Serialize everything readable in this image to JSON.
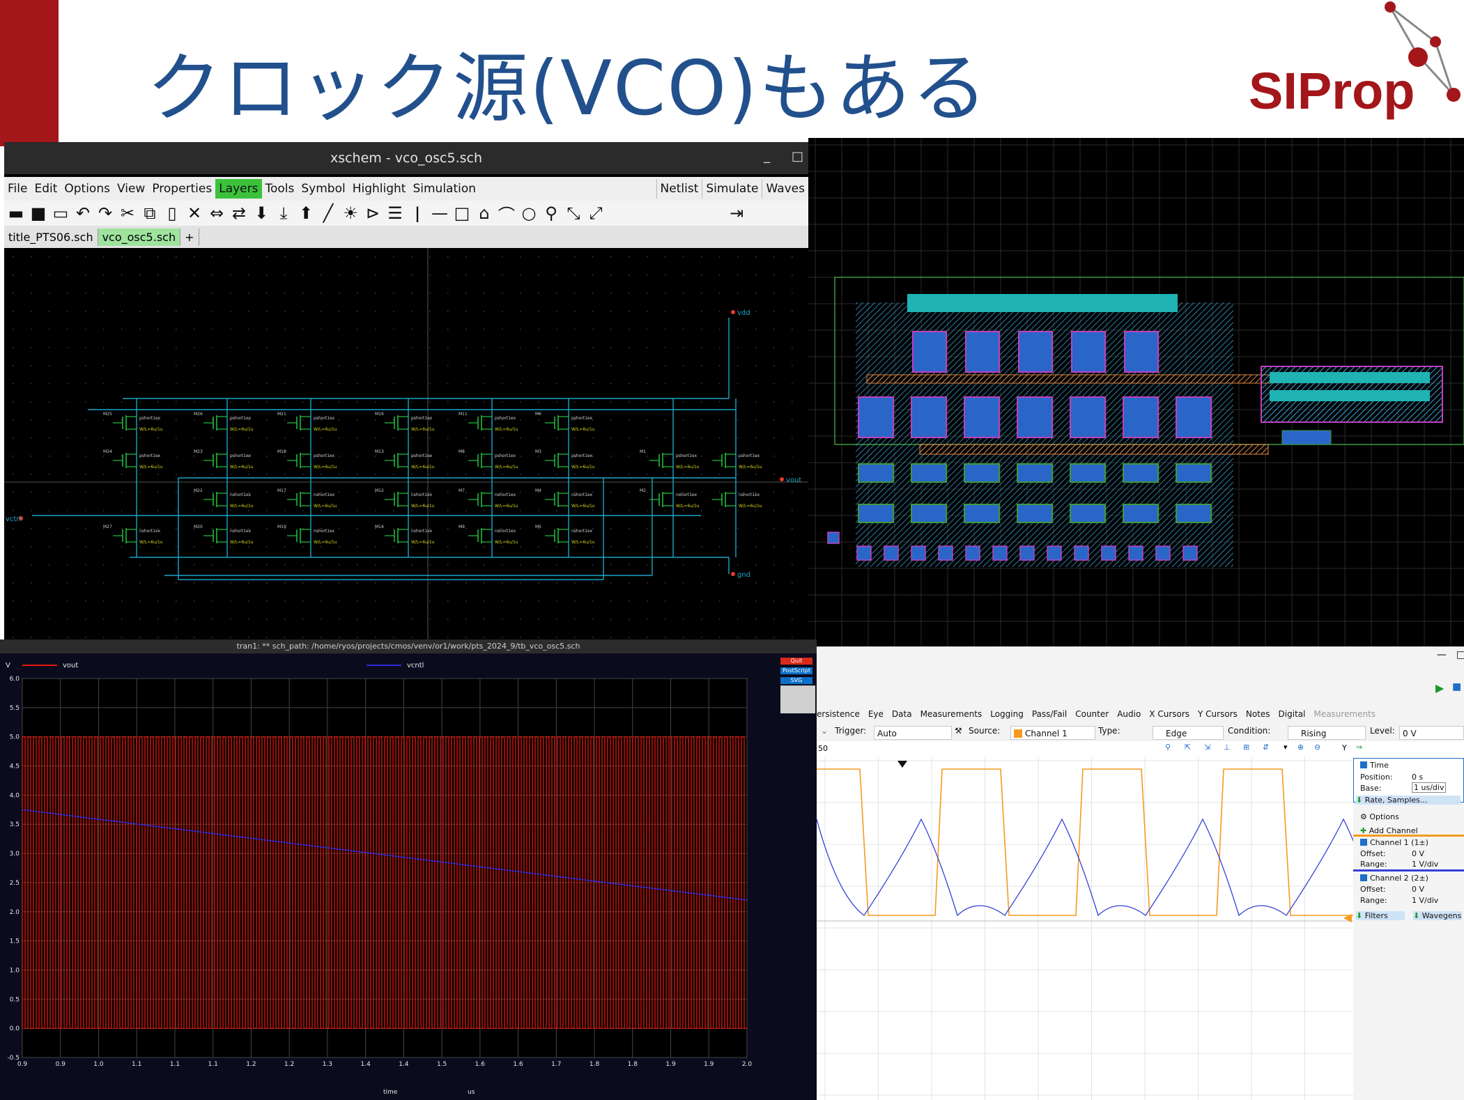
{
  "slide": {
    "title": "クロック源(VCO)もある",
    "logo_text": "SIProp",
    "colors": {
      "accent_red": "#a3161a",
      "title_blue": "#22508d"
    }
  },
  "xschem": {
    "window_title": "xschem - vco_osc5.sch",
    "menu": [
      "File",
      "Edit",
      "Options",
      "View",
      "Properties",
      "Layers",
      "Tools",
      "Symbol",
      "Highlight",
      "Simulation"
    ],
    "menu_right": [
      "Netlist",
      "Simulate",
      "Waves"
    ],
    "tabs": [
      "title_PTS06.sch",
      "vco_osc5.sch",
      "+"
    ],
    "net_labels": {
      "vdd": "vdd",
      "vout": "vout",
      "vctrl": "vctrl",
      "gnd": "gnd"
    },
    "pmos_top": [
      "M25",
      "M26",
      "M21",
      "M16",
      "M11",
      "M6"
    ],
    "pmos_mid": [
      "M24",
      "M23",
      "M18",
      "M13",
      "M8",
      "M3",
      "M1"
    ],
    "nmos_mid": [
      "M22",
      "M17",
      "M12",
      "M7",
      "M4",
      "M2"
    ],
    "nmos_bot": [
      "M27",
      "M20",
      "M19",
      "M14",
      "M9",
      "M5"
    ],
    "dev_text": {
      "pmos": "pshort1ex",
      "nmos": "nshort1ex",
      "wl": "W/L=6u/1u"
    }
  },
  "waveform": {
    "title": "tran1: ** sch_path: /home/ryos/projects/cmos/venv/or1/work/pts_2024_9/tb_vco_osc5.sch",
    "ylabel": "V",
    "xlabel": "time",
    "xunit": "us",
    "buttons": [
      "Quit",
      "PostScript",
      "SVG"
    ]
  },
  "chart_data": {
    "type": "line",
    "title": "",
    "xlabel": "time",
    "ylabel": "V",
    "xlim": [
      0.9,
      2.0
    ],
    "ylim": [
      -0.5,
      6.0
    ],
    "x_ticks": [
      "0.9",
      "0.9",
      "1.0",
      "1.1",
      "1.1",
      "1.1",
      "1.2",
      "1.2",
      "1.3",
      "1.4",
      "1.4",
      "1.5",
      "1.6",
      "1.6",
      "1.7",
      "1.8",
      "1.8",
      "1.9",
      "1.9",
      "2.0"
    ],
    "y_ticks": [
      "-0.5",
      "0.0",
      "0.5",
      "1.0",
      "1.5",
      "2.0",
      "2.5",
      "3.0",
      "3.5",
      "4.0",
      "4.5",
      "5.0",
      "5.5",
      "6.0"
    ],
    "series": [
      {
        "name": "vout",
        "color": "#e8160c",
        "style": "square oscillation between 0.0 V and 5.0 V",
        "x": [
          0.9,
          2.0
        ],
        "low": 0.0,
        "high": 5.0,
        "cycles": 130
      },
      {
        "name": "vcntl",
        "color": "#2b2bd6",
        "x": [
          0.9,
          2.0
        ],
        "values": [
          3.75,
          2.2
        ]
      }
    ]
  },
  "scope": {
    "menu": [
      "ersistence",
      "Eye",
      "Data",
      "Measurements",
      "Logging",
      "Pass/Fail",
      "Counter",
      "Audio",
      "X Cursors",
      "Y Cursors",
      "Notes",
      "Digital",
      "Measurements"
    ],
    "trigger_label": "Trigger:",
    "trigger_value": "Auto",
    "source_label": "Source:",
    "source_value": "Channel 1",
    "type_label": "Type:",
    "type_value": "Edge",
    "condition_label": "Condition:",
    "condition_value": "Rising",
    "level_label": "Level:",
    "level_value": "0 V",
    "axis_start": "50",
    "y_btn": "Y",
    "panel": {
      "time": "Time",
      "position_label": "Position:",
      "position_value": "0 s",
      "base_label": "Base:",
      "base_value": "1 us/div",
      "rate": "Rate, Samples...",
      "options": "Options",
      "add_channel": "Add Channel",
      "ch1": "Channel 1 (1±)",
      "ch2": "Channel 2 (2±)",
      "offset_label": "Offset:",
      "offset_value": "0 V",
      "range_label": "Range:",
      "range_value": "1 V/div",
      "filters": "Filters",
      "wavegen": "Wavegens"
    },
    "colors": {
      "ch1": "#f59a1e",
      "ch2": "#3340d8"
    }
  }
}
